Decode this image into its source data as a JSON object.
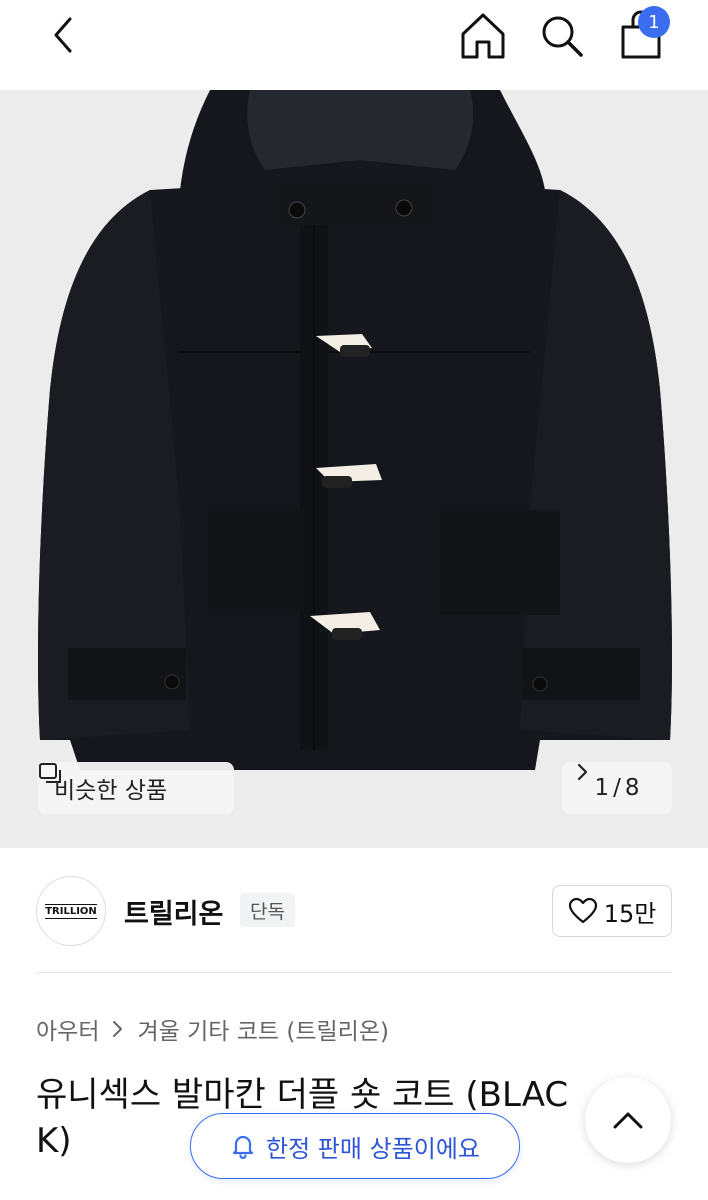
{
  "header": {
    "cart_count": "1",
    "icons": [
      "back-icon",
      "home-icon",
      "search-icon",
      "shopping-bag-icon"
    ]
  },
  "gallery": {
    "similar_label": "비슷한 상품",
    "current_index": "1",
    "separator": "/",
    "total": "8",
    "background_color": "#ececec",
    "coat_color": "#15171c"
  },
  "brand": {
    "logo_text": "TRILLION",
    "name": "트릴리온",
    "tag": "단독",
    "likes": "15만"
  },
  "breadcrumb": {
    "category": "아우터",
    "subcategory": "겨울 기타 코트 (트릴리온)"
  },
  "product": {
    "title": "유니섹스 발마칸 더플 숏 코트 (BLACK)"
  },
  "notice": {
    "limited_label": "한정 판매 상품이에요",
    "accent_color": "#3a6df0"
  }
}
